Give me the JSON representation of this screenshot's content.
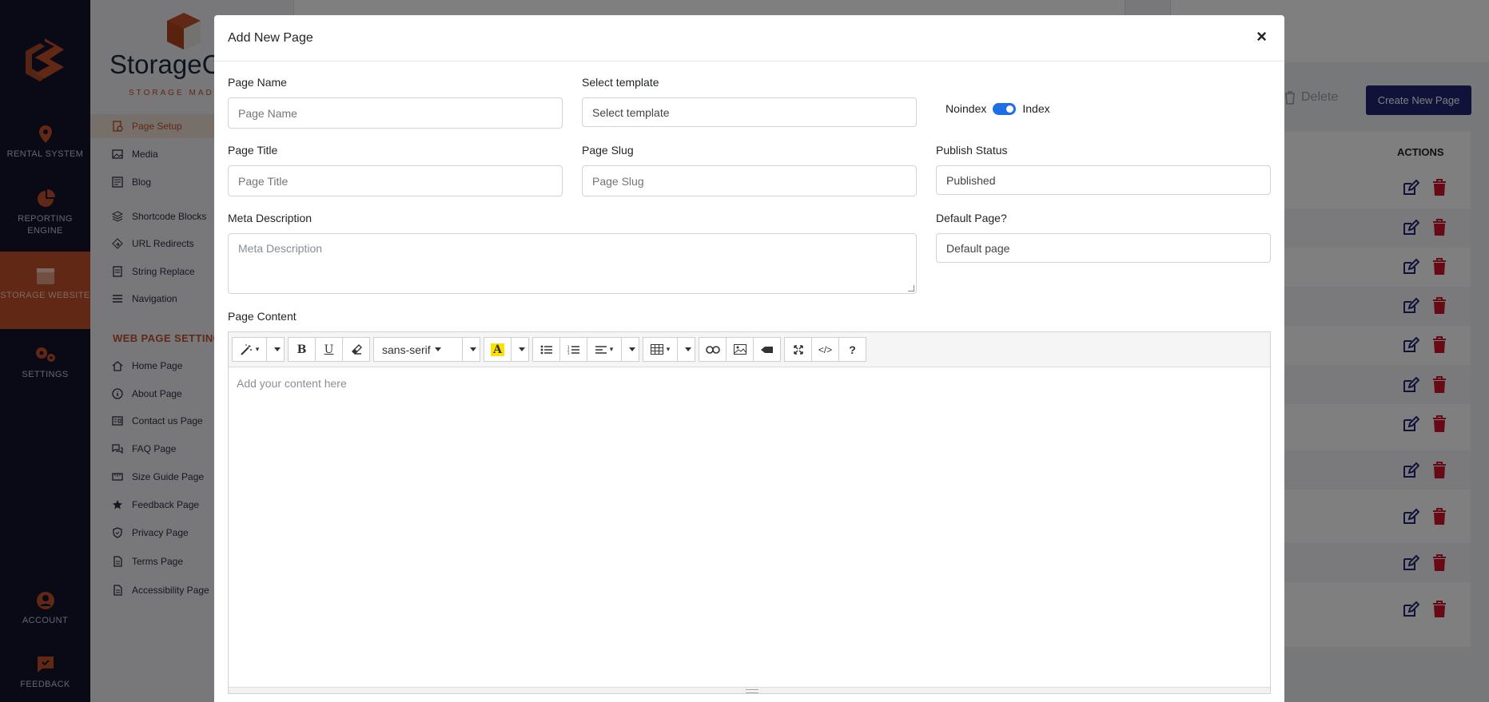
{
  "rail": {
    "items": [
      {
        "label": "RENTAL SYSTEM"
      },
      {
        "label": "REPORTING ENGINE"
      },
      {
        "label": "STORAGE WEBSITE"
      },
      {
        "label": "SETTINGS"
      },
      {
        "label": "ACCOUNT"
      },
      {
        "label": "FEEDBACK"
      }
    ]
  },
  "sidebar": {
    "brand_name": "StorageC",
    "brand_tag": "STORAGE MADE",
    "items": [
      {
        "label": "Page Setup",
        "icon": "page-setup-icon"
      },
      {
        "label": "Media",
        "icon": "media-icon"
      },
      {
        "label": "Blog",
        "icon": "blog-icon"
      },
      {
        "label": "Shortcode Blocks",
        "icon": "shortcode-icon"
      },
      {
        "label": "URL Redirects",
        "icon": "redirect-icon"
      },
      {
        "label": "String Replace",
        "icon": "string-replace-icon"
      },
      {
        "label": "Navigation",
        "icon": "navigation-icon"
      }
    ],
    "section_title": "WEB PAGE SETTING",
    "page_items": [
      {
        "label": "Home Page",
        "icon": "home-icon"
      },
      {
        "label": "About Page",
        "icon": "info-icon"
      },
      {
        "label": "Contact us Page",
        "icon": "contact-icon"
      },
      {
        "label": "FAQ Page",
        "icon": "faq-icon"
      },
      {
        "label": "Size Guide Page",
        "icon": "size-guide-icon"
      },
      {
        "label": "Feedback Page",
        "icon": "star-icon"
      },
      {
        "label": "Privacy Page",
        "icon": "shield-icon"
      },
      {
        "label": "Terms Page",
        "icon": "document-icon"
      },
      {
        "label": "Accessibility Page",
        "icon": "document-icon"
      }
    ]
  },
  "background": {
    "create_button": "Create New Page",
    "delete_button": "Delete",
    "actions_header": "ACTIONS"
  },
  "modal": {
    "title": "Add New Page",
    "close": "×",
    "page_name": {
      "label": "Page Name",
      "placeholder": "Page Name"
    },
    "select_template": {
      "label": "Select template",
      "value": "Select template"
    },
    "noindex_label": "Noindex",
    "index_label": "Index",
    "page_title": {
      "label": "Page Title",
      "placeholder": "Page Title"
    },
    "page_slug": {
      "label": "Page Slug",
      "placeholder": "Page Slug"
    },
    "publish_status": {
      "label": "Publish Status",
      "value": "Published"
    },
    "meta_description": {
      "label": "Meta Description",
      "placeholder": "Meta Description"
    },
    "default_page": {
      "label": "Default Page?",
      "value": "Default page"
    },
    "page_content": {
      "label": "Page Content",
      "placeholder": "Add your content here"
    },
    "font_select": "sans-serif"
  },
  "colors": {
    "rail_bg": "#15142d",
    "accent": "#c3512a",
    "primary_button": "#202473",
    "toggle_on": "#1e6ee8",
    "delete_red": "#d0142c"
  }
}
